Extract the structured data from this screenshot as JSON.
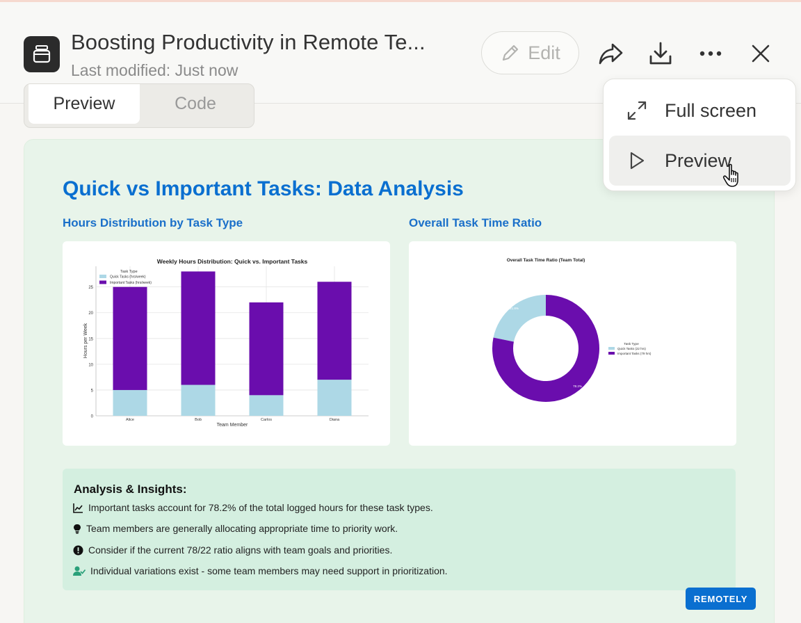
{
  "header": {
    "title": "Boosting Productivity in Remote Te...",
    "subtitle": "Last modified: Just now",
    "edit_label": "Edit"
  },
  "tabs": [
    {
      "label": "Preview",
      "active": true
    },
    {
      "label": "Code",
      "active": false
    }
  ],
  "menu": {
    "items": [
      {
        "label": "Full screen",
        "icon": "expand-icon"
      },
      {
        "label": "Preview",
        "icon": "play-icon",
        "hovered": true
      }
    ]
  },
  "report": {
    "title": "Quick vs Important Tasks: Data Analysis",
    "left_heading": "Hours Distribution by Task Type",
    "right_heading": "Overall Task Time Ratio",
    "insights_title": "Analysis & Insights:",
    "insights": [
      {
        "icon": "chart-line-icon",
        "text": "Important tasks account for 78.2% of the total logged hours for these task types."
      },
      {
        "icon": "lightbulb-icon",
        "text": "Team members are generally allocating appropriate time to priority work."
      },
      {
        "icon": "exclamation-circle-icon",
        "text": "Consider if the current 78/22 ratio aligns with team goals and priorities."
      },
      {
        "icon": "user-check-icon",
        "text": "Individual variations exist - some team members may need support in prioritization."
      }
    ],
    "badge": "REMOTELY"
  },
  "colors": {
    "quick": "#add8e6",
    "important": "#6a0dad",
    "accent": "#0a6fd0"
  },
  "chart_data": [
    {
      "type": "bar",
      "title": "Weekly Hours Distribution: Quick vs. Important Tasks",
      "xlabel": "Team Member",
      "ylabel": "Hours per Week",
      "legend_title": "Task Type",
      "legend_position": "top-left",
      "categories": [
        "Alice",
        "Bob",
        "Carlos",
        "Diana"
      ],
      "series": [
        {
          "name": "Quick Tasks (hrs/week)",
          "values": [
            5,
            6,
            4,
            7
          ]
        },
        {
          "name": "Important Tasks (hrs/week)",
          "values": [
            20,
            22,
            18,
            19
          ]
        }
      ],
      "stacked": true,
      "ylim": [
        0,
        29
      ],
      "yticks": [
        0,
        5,
        10,
        15,
        20,
        25
      ],
      "grid": true
    },
    {
      "type": "pie",
      "title": "Overall Task Time Ratio (Team Total)",
      "legend_title": "Task Type",
      "legend_position": "right",
      "labels": [
        "Quick Tasks (22 hrs)",
        "Important Tasks (79 hrs)"
      ],
      "values": [
        22,
        79
      ],
      "slice_labels": [
        "21.8%",
        "78.2%"
      ],
      "donut": true
    }
  ]
}
